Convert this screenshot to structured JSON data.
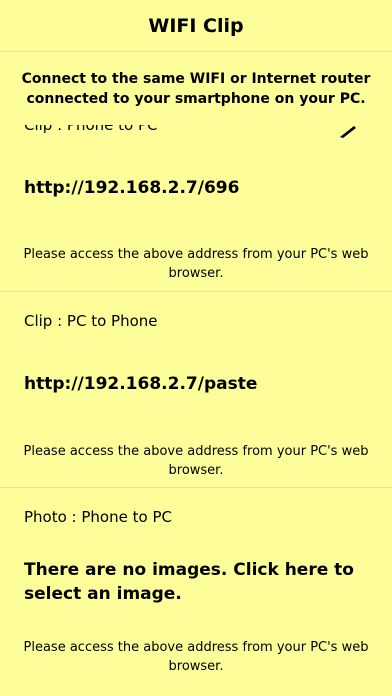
{
  "nav": {
    "title": "WIFI Clip"
  },
  "banner": {
    "text": "Connect to the same WIFI or Internet router connected to your smartphone on your PC."
  },
  "sections": [
    {
      "title": "Clip : Phone to PC",
      "address": "http://192.168.2.7/696",
      "note": "Please access the above address from your PC's web browser."
    },
    {
      "title": "Clip : PC to Phone",
      "address": "http://192.168.2.7/paste",
      "note": "Please access the above address from your PC's web browser."
    },
    {
      "title": "Photo : Phone to PC",
      "action": "There are no images. Click here to select an image.",
      "note": "Please access the above address from your PC's web browser."
    }
  ],
  "icons": {
    "edit": "pencil-icon"
  }
}
